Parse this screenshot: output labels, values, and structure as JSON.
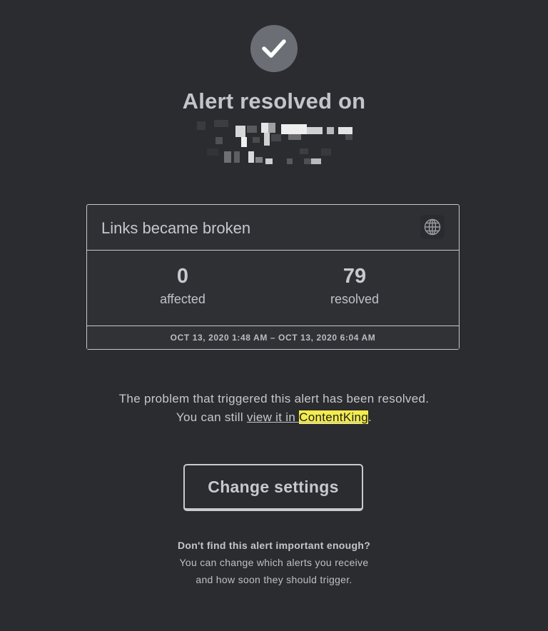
{
  "header": {
    "icon": "checkmark-icon",
    "title": "Alert resolved on"
  },
  "card": {
    "title": "Links became broken",
    "icon": "globe-icon",
    "stats": [
      {
        "value": "0",
        "label": "affected"
      },
      {
        "value": "79",
        "label": "resolved"
      }
    ],
    "time_range": "OCT 13, 2020 1:48 AM – OCT 13, 2020 6:04 AM"
  },
  "message": {
    "line1": "The problem that triggered this alert has been resolved.",
    "line2_prefix": "You can still ",
    "link_text_plain": "view it in ",
    "link_text_highlight": "ContentKing",
    "line2_suffix": "."
  },
  "button": {
    "label": "Change settings"
  },
  "note": {
    "question": "Don't find this alert important enough?",
    "line1": "You can change which alerts you receive",
    "line2": "and how soon they should trigger."
  },
  "colors": {
    "background": "#2b2c2f",
    "highlight": "#f4ec4d",
    "check_circle": "#6b6e74"
  }
}
